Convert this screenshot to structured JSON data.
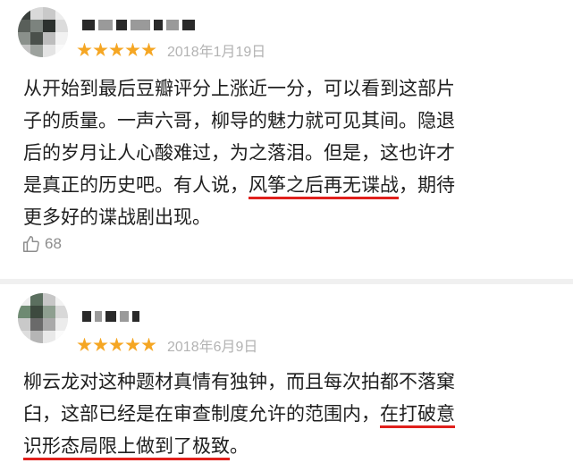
{
  "reviews": [
    {
      "rating_stars": 5,
      "date": "2018年1月19日",
      "lines": [
        [
          {
            "text": "从开始到最后豆瓣评分上涨近一分，可以看到这部片",
            "underline": false
          }
        ],
        [
          {
            "text": "子的质量。一声六哥，柳导的魅力就可见其间。隐退",
            "underline": false
          }
        ],
        [
          {
            "text": "后的岁月让人心酸难过，为之落泪。但是，这也许才",
            "underline": false
          }
        ],
        [
          {
            "text": "是真正的历史吧。有人说，",
            "underline": false
          },
          {
            "text": "风筝之后再无谍战",
            "underline": true
          },
          {
            "text": "，期待",
            "underline": false
          }
        ],
        [
          {
            "text": "更多好的谍战剧出现。",
            "underline": false
          }
        ]
      ],
      "likes": "68"
    },
    {
      "rating_stars": 5,
      "date": "2018年6月9日",
      "lines": [
        [
          {
            "text": "柳云龙对这种题材真情有独钟，而且每次拍都不落窠",
            "underline": false
          }
        ],
        [
          {
            "text": "臼，这部已经是在审查制度允许的范围内，",
            "underline": false
          },
          {
            "text": "在打破意",
            "underline": true
          }
        ],
        [
          {
            "text": "识形态局限上做到了极致",
            "underline": true
          },
          {
            "text": "。",
            "underline": false
          }
        ]
      ]
    }
  ],
  "colors": {
    "star": "#f5a623",
    "underline": "#e0201c",
    "date": "#b3b3b3",
    "text": "#1f1f1f"
  },
  "icons": {
    "like": "thumbs-up-icon",
    "star": "star-icon"
  }
}
